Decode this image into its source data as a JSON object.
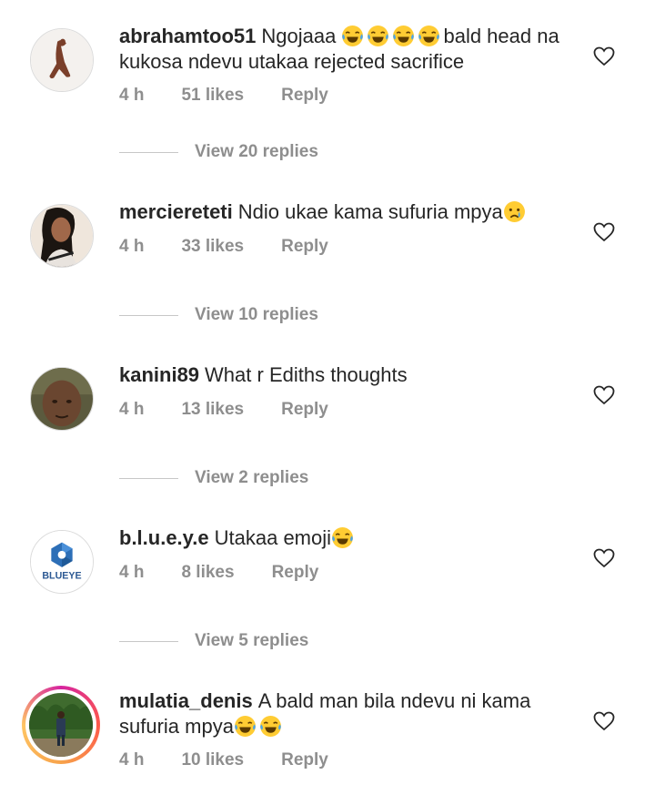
{
  "comments": [
    {
      "username": "abrahamtoo51",
      "text_before": "Ngojaaa",
      "emojis": [
        "laughing-crying",
        "laughing-crying",
        "laughing-crying",
        "laughing-crying"
      ],
      "text_after": "bald head na kukosa ndevu utakaa rejected sacrifice",
      "time": "4 h",
      "likes": "51 likes",
      "reply": "Reply",
      "view_replies": "View 20 replies"
    },
    {
      "username": "merciereteti",
      "text_before": "Ndio ukae kama sufuria mpya",
      "emojis": [
        "crying-sad"
      ],
      "text_after": "",
      "time": "4 h",
      "likes": "33 likes",
      "reply": "Reply",
      "view_replies": "View 10 replies"
    },
    {
      "username": "kanini89",
      "text_before": "What r Ediths thoughts",
      "emojis": [],
      "text_after": "",
      "time": "4 h",
      "likes": "13 likes",
      "reply": "Reply",
      "view_replies": "View 2 replies"
    },
    {
      "username": "b.l.u.e.y.e",
      "text_before": "Utakaa emoji",
      "emojis": [
        "laughing-crying"
      ],
      "text_after": "",
      "time": "4 h",
      "likes": "8 likes",
      "reply": "Reply",
      "view_replies": "View 5 replies",
      "avatar_logo_text": "BLUEYE"
    },
    {
      "username": "mulatia_denis",
      "text_before": "A bald man bila ndevu ni kama sufuria mpya",
      "emojis": [
        "laughing-crying",
        "laughing-crying"
      ],
      "text_after": "",
      "time": "4 h",
      "likes": "10 likes",
      "reply": "Reply"
    }
  ],
  "colors": {
    "text": "#262626",
    "muted": "#8e8e8e",
    "divider": "#c7c7c7",
    "story_ring": "#d6249f"
  },
  "icons": {
    "like": "heart-outline-icon"
  }
}
